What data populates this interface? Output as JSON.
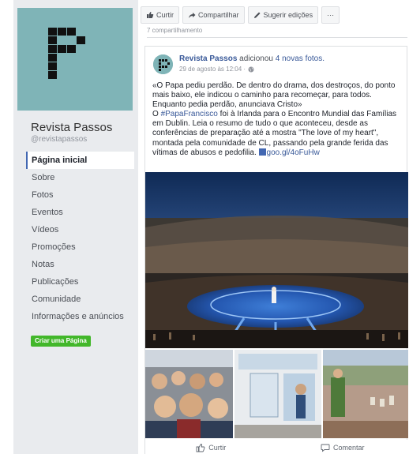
{
  "page": {
    "name": "Revista Passos",
    "handle": "@revistapassos"
  },
  "nav": {
    "items": [
      {
        "label": "Página inicial"
      },
      {
        "label": "Sobre"
      },
      {
        "label": "Fotos"
      },
      {
        "label": "Eventos"
      },
      {
        "label": "Vídeos"
      },
      {
        "label": "Promoções"
      },
      {
        "label": "Notas"
      },
      {
        "label": "Publicações"
      },
      {
        "label": "Comunidade"
      },
      {
        "label": "Informações e anúncios"
      }
    ],
    "create_page_label": "Criar uma Página"
  },
  "action_bar": {
    "like_label": "Curtir",
    "share_label": "Compartilhar",
    "suggest_label": "Sugerir edições",
    "more_label": "···"
  },
  "previous_post_strip": "7 compartilhamento",
  "post": {
    "author": "Revista Passos",
    "action_text": "adicionou",
    "photos_link": "4 novas fotos.",
    "timestamp": "29 de agosto às 12:04 ·",
    "text_quote": "«O Papa pediu perdão. De dentro do drama, dos destroços, do ponto mais baixo, ele indicou o caminho para recomeçar, para todos. Enquanto pedia perdão, anunciava Cristo»",
    "text_before_hashtag": "O ",
    "hashtag": "#PapaFrancisco",
    "text_body": " foi à Irlanda para o Encontro Mundial das Famílias em Dublin. Leia o resumo de tudo o que aconteceu, desde as conferências de preparação até a mostra \"The love of my heart\", montada pela comunidade de CL, passando pela grande ferida das vítimas de abusos e pedofilia. ",
    "link": "goo.gl/4oFuHw",
    "like_button": "Curtir",
    "comment_button": "Comentar"
  },
  "colors": {
    "sidebar_bg": "#e9ebee",
    "cover_bg": "#7fb4b7",
    "link": "#385898",
    "create_button": "#42b72a"
  }
}
